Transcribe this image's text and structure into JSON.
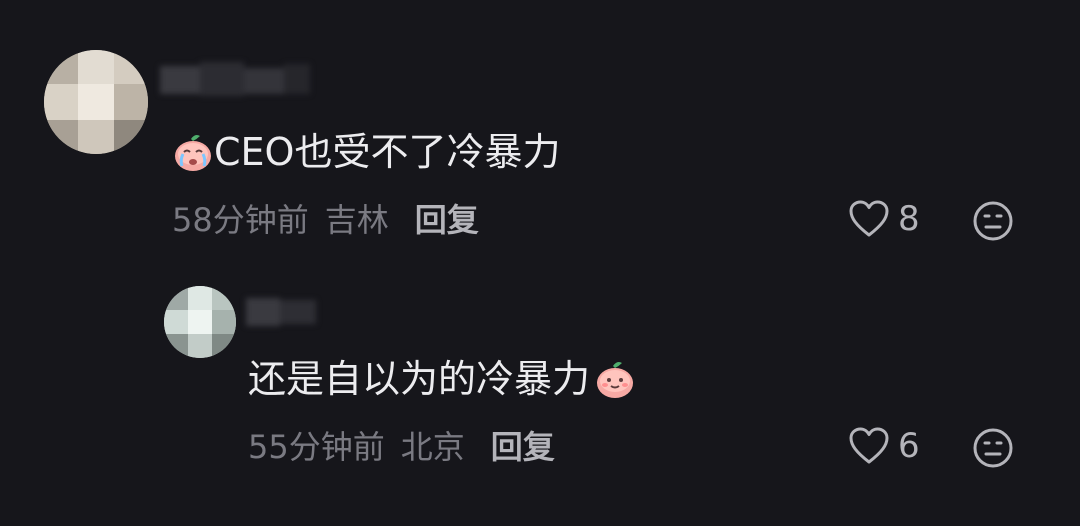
{
  "comments": [
    {
      "text": "CEO也受不了冷暴力",
      "emoji": "crying-peach-emoji",
      "time": "58分钟前",
      "location": "吉林",
      "reply_label": "回复",
      "likes": "8"
    },
    {
      "text": "还是自以为的冷暴力",
      "emoji": "smiling-peach-emoji",
      "time": "55分钟前",
      "location": "北京",
      "reply_label": "回复",
      "likes": "6"
    }
  ],
  "icons": {
    "like": "heart-icon",
    "reaction": "neutral-face-icon"
  },
  "colors": {
    "background": "#16161b",
    "text": "#ececef",
    "meta": "#7a7a82",
    "reply": "#b4b4ba"
  }
}
